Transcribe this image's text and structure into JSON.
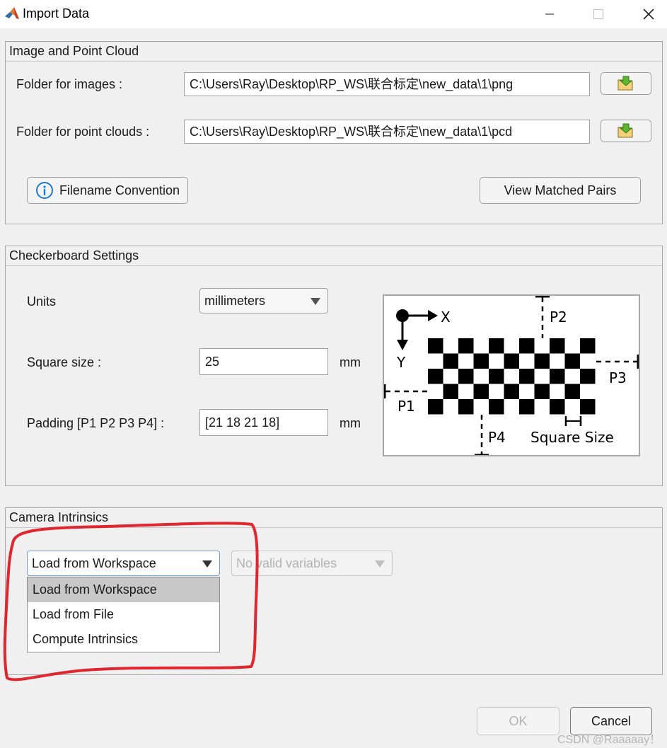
{
  "window": {
    "title": "Import Data",
    "icon": "matlab-logo-icon"
  },
  "image_panel": {
    "title": "Image and Point Cloud",
    "images_label": "Folder for images :",
    "images_path": "C:\\Users\\Ray\\Desktop\\RP_WS\\联合标定\\new_data\\1\\png",
    "clouds_label": "Folder for point clouds :",
    "clouds_path": "C:\\Users\\Ray\\Desktop\\RP_WS\\联合标定\\new_data\\1\\pcd",
    "browse_icon": "folder-open-icon",
    "filename_convention": "Filename Convention",
    "view_pairs": "View Matched Pairs"
  },
  "checkerboard": {
    "title": "Checkerboard Settings",
    "units_label": "Units",
    "units_value": "millimeters",
    "square_label": "Square size :",
    "square_value": "25",
    "square_unit": "mm",
    "padding_label": "Padding [P1 P2 P3 P4] :",
    "padding_value": "[21 18 21 18]",
    "padding_unit": "mm",
    "diagram": {
      "x": "X",
      "y": "Y",
      "p1": "P1",
      "p2": "P2",
      "p3": "P3",
      "p4": "P4",
      "square_size": "Square Size"
    }
  },
  "intrinsics": {
    "title": "Camera Intrinsics",
    "source_value": "Load from Workspace",
    "variable_value": "No valid variables",
    "options": [
      "Load from Workspace",
      "Load from File",
      "Compute Intrinsics"
    ],
    "selected_option": "Load from Workspace"
  },
  "footer": {
    "ok": "OK",
    "cancel": "Cancel"
  },
  "watermark": "CSDN @Raaaaay！",
  "colors": {
    "annotation_red": "#e0262e",
    "menu_highlight": "#c8c8c8",
    "info_blue": "#1b7ad1",
    "folder_green": "#5cb82e",
    "disabled_text": "#b3b3b3"
  }
}
